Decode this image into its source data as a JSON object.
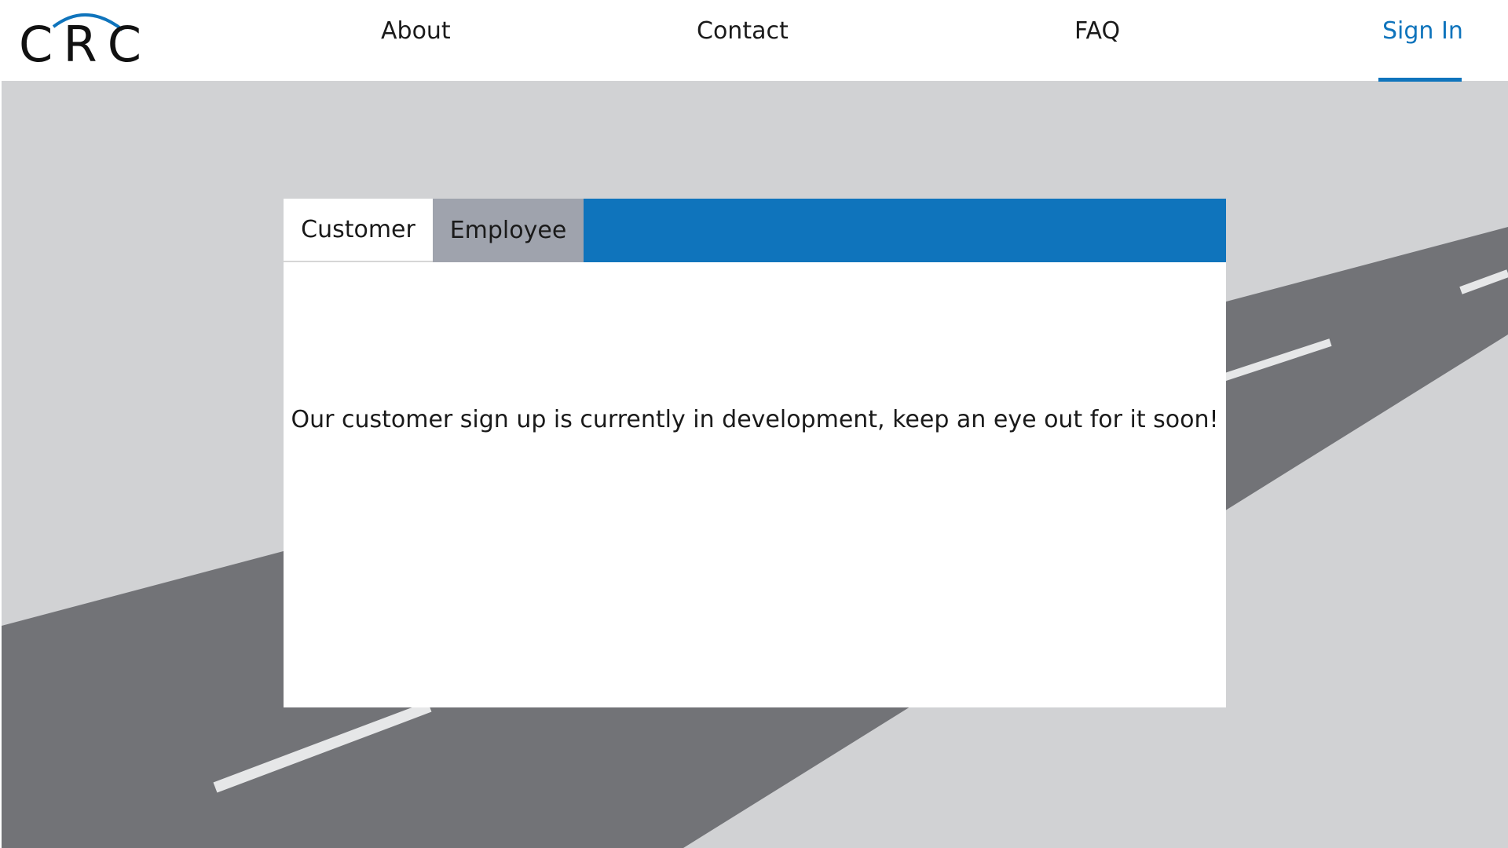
{
  "header": {
    "logo": {
      "letters": [
        "C",
        "R",
        "C"
      ],
      "icon": "crc-arc-logo-icon",
      "arc_color": "#0f74bc"
    },
    "nav": {
      "about": "About",
      "contact": "Contact",
      "faq": "FAQ",
      "sign_in": "Sign In"
    },
    "active_nav": "Sign In",
    "accent_color": "#0f74bc"
  },
  "signup_card": {
    "tabs": [
      {
        "label": "Customer",
        "active": true
      },
      {
        "label": "Employee",
        "active": false
      }
    ],
    "message": "Our customer sign up is currently in development, keep an eye out for it soon!"
  },
  "background": {
    "icon": "road-illustration",
    "colors": {
      "sky": "#d1d2d4",
      "road": "#727377",
      "lane_marks": "#e6e7e8"
    }
  }
}
